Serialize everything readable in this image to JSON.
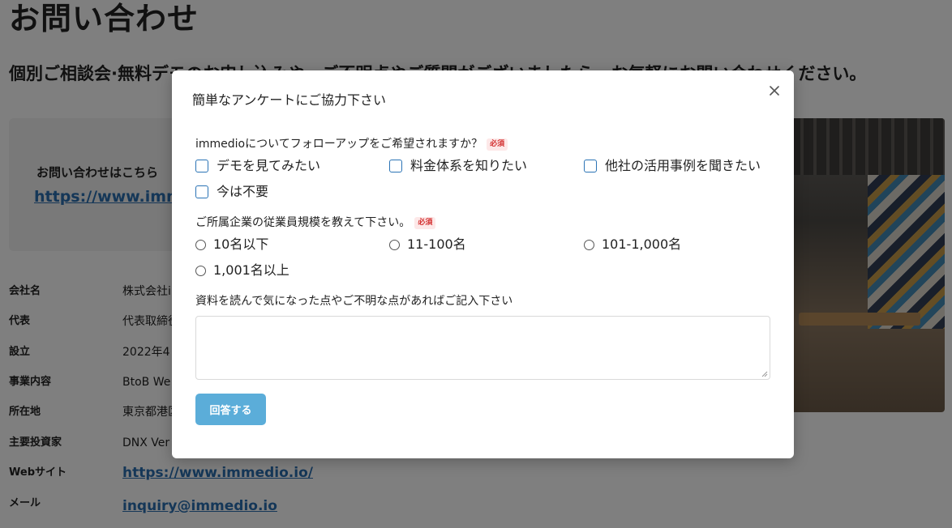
{
  "page": {
    "title": "お問い合わせ",
    "subtitle": "個別ご相談会·無料デモのお申し込みや、ご不明点やご質問がございましたら、お気軽にお問い合わせください。",
    "contact_label": "お問い合わせはこちら",
    "contact_link": "https://www.imme",
    "info": [
      {
        "key": "会社名",
        "value": "株式会社i"
      },
      {
        "key": "代表",
        "value": "代表取締役"
      },
      {
        "key": "設立",
        "value": "2022年4"
      },
      {
        "key": "事業内容",
        "value": "BtoB We"
      },
      {
        "key": "所在地",
        "value": "東京都港区"
      },
      {
        "key": "主要投資家",
        "value": "DNX Ver"
      },
      {
        "key": "Webサイト",
        "value": "https://www.immedio.io/"
      },
      {
        "key": "メール",
        "value": "inquiry@immedio.io"
      }
    ]
  },
  "modal": {
    "title": "簡単なアンケートにご協力下さい",
    "required_label": "必須",
    "q1": {
      "label": "immedioについてフォローアップをご希望されますか？",
      "options": [
        "デモを見てみたい",
        "料金体系を知りたい",
        "他社の活用事例を聞きたい",
        "今は不要"
      ]
    },
    "q2": {
      "label": "ご所属企業の従業員規模を教えて下さい。",
      "options": [
        "10名以下",
        "11-100名",
        "101-1,000名",
        "1,001名以上"
      ]
    },
    "q3": {
      "label": "資料を読んで気になった点やご不明な点があればご記入下さい",
      "value": ""
    },
    "submit_label": "回答する"
  },
  "colors": {
    "accent": "#5badd9",
    "checkbox_border": "#2a73b5",
    "required": "#d32f2f",
    "overlay": "rgba(0,0,0,0.5)"
  }
}
